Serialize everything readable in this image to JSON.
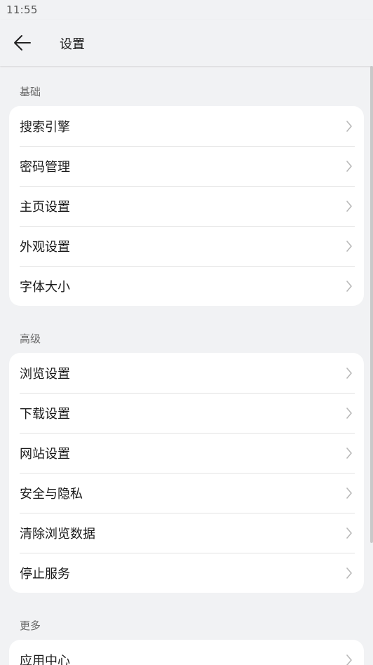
{
  "status_bar": {
    "time": "11:55"
  },
  "header": {
    "title": "设置",
    "back_icon": "arrow-left-icon"
  },
  "sections": [
    {
      "title": "基础",
      "items": [
        "搜索引擎",
        "密码管理",
        "主页设置",
        "外观设置",
        "字体大小"
      ]
    },
    {
      "title": "高级",
      "items": [
        "浏览设置",
        "下载设置",
        "网站设置",
        "安全与隐私",
        "清除浏览数据",
        "停止服务"
      ]
    },
    {
      "title": "更多",
      "items": [
        "应用中心"
      ]
    }
  ],
  "colors": {
    "background": "#f1f2f4",
    "card": "#ffffff",
    "divider": "#e2e2e2",
    "chevron": "#b8b8b8"
  }
}
